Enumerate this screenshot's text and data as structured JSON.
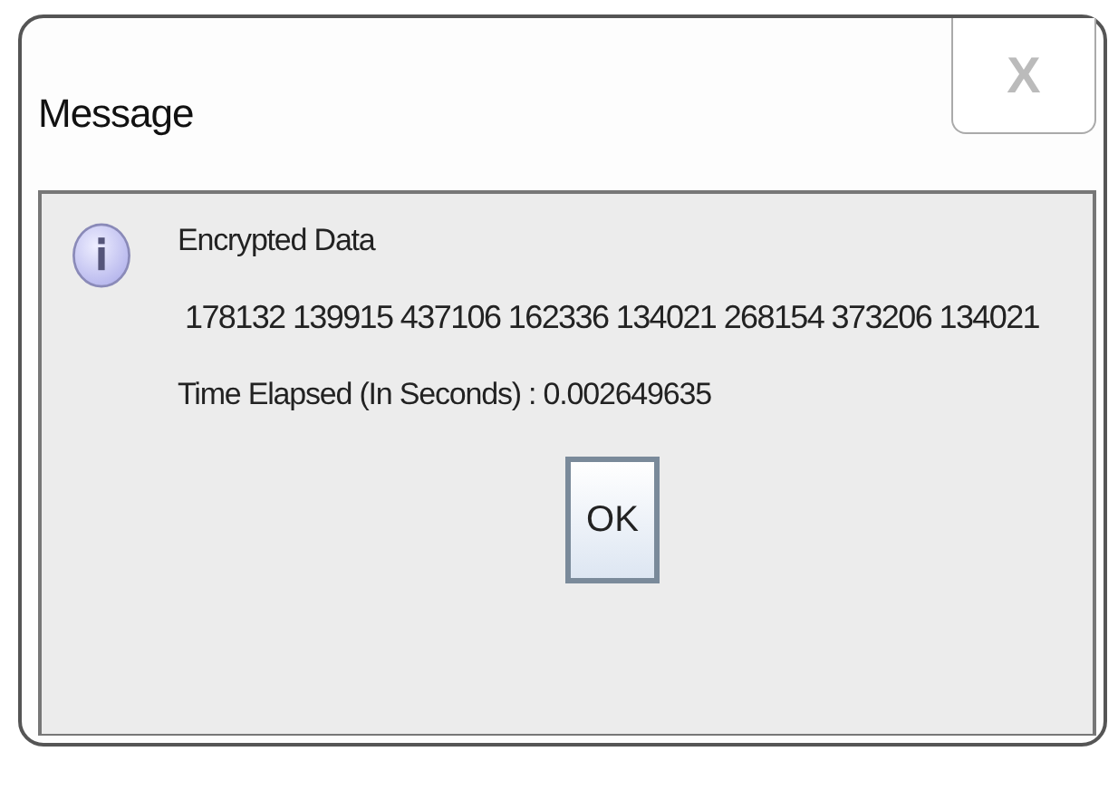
{
  "window": {
    "title": "Message",
    "close_label": "X"
  },
  "message": {
    "heading": "Encrypted Data",
    "data": "178132 139915 437106 162336 134021 268154 373206 134021",
    "time": "Time Elapsed (In Seconds) : 0.002649635"
  },
  "buttons": [
    "OK"
  ]
}
